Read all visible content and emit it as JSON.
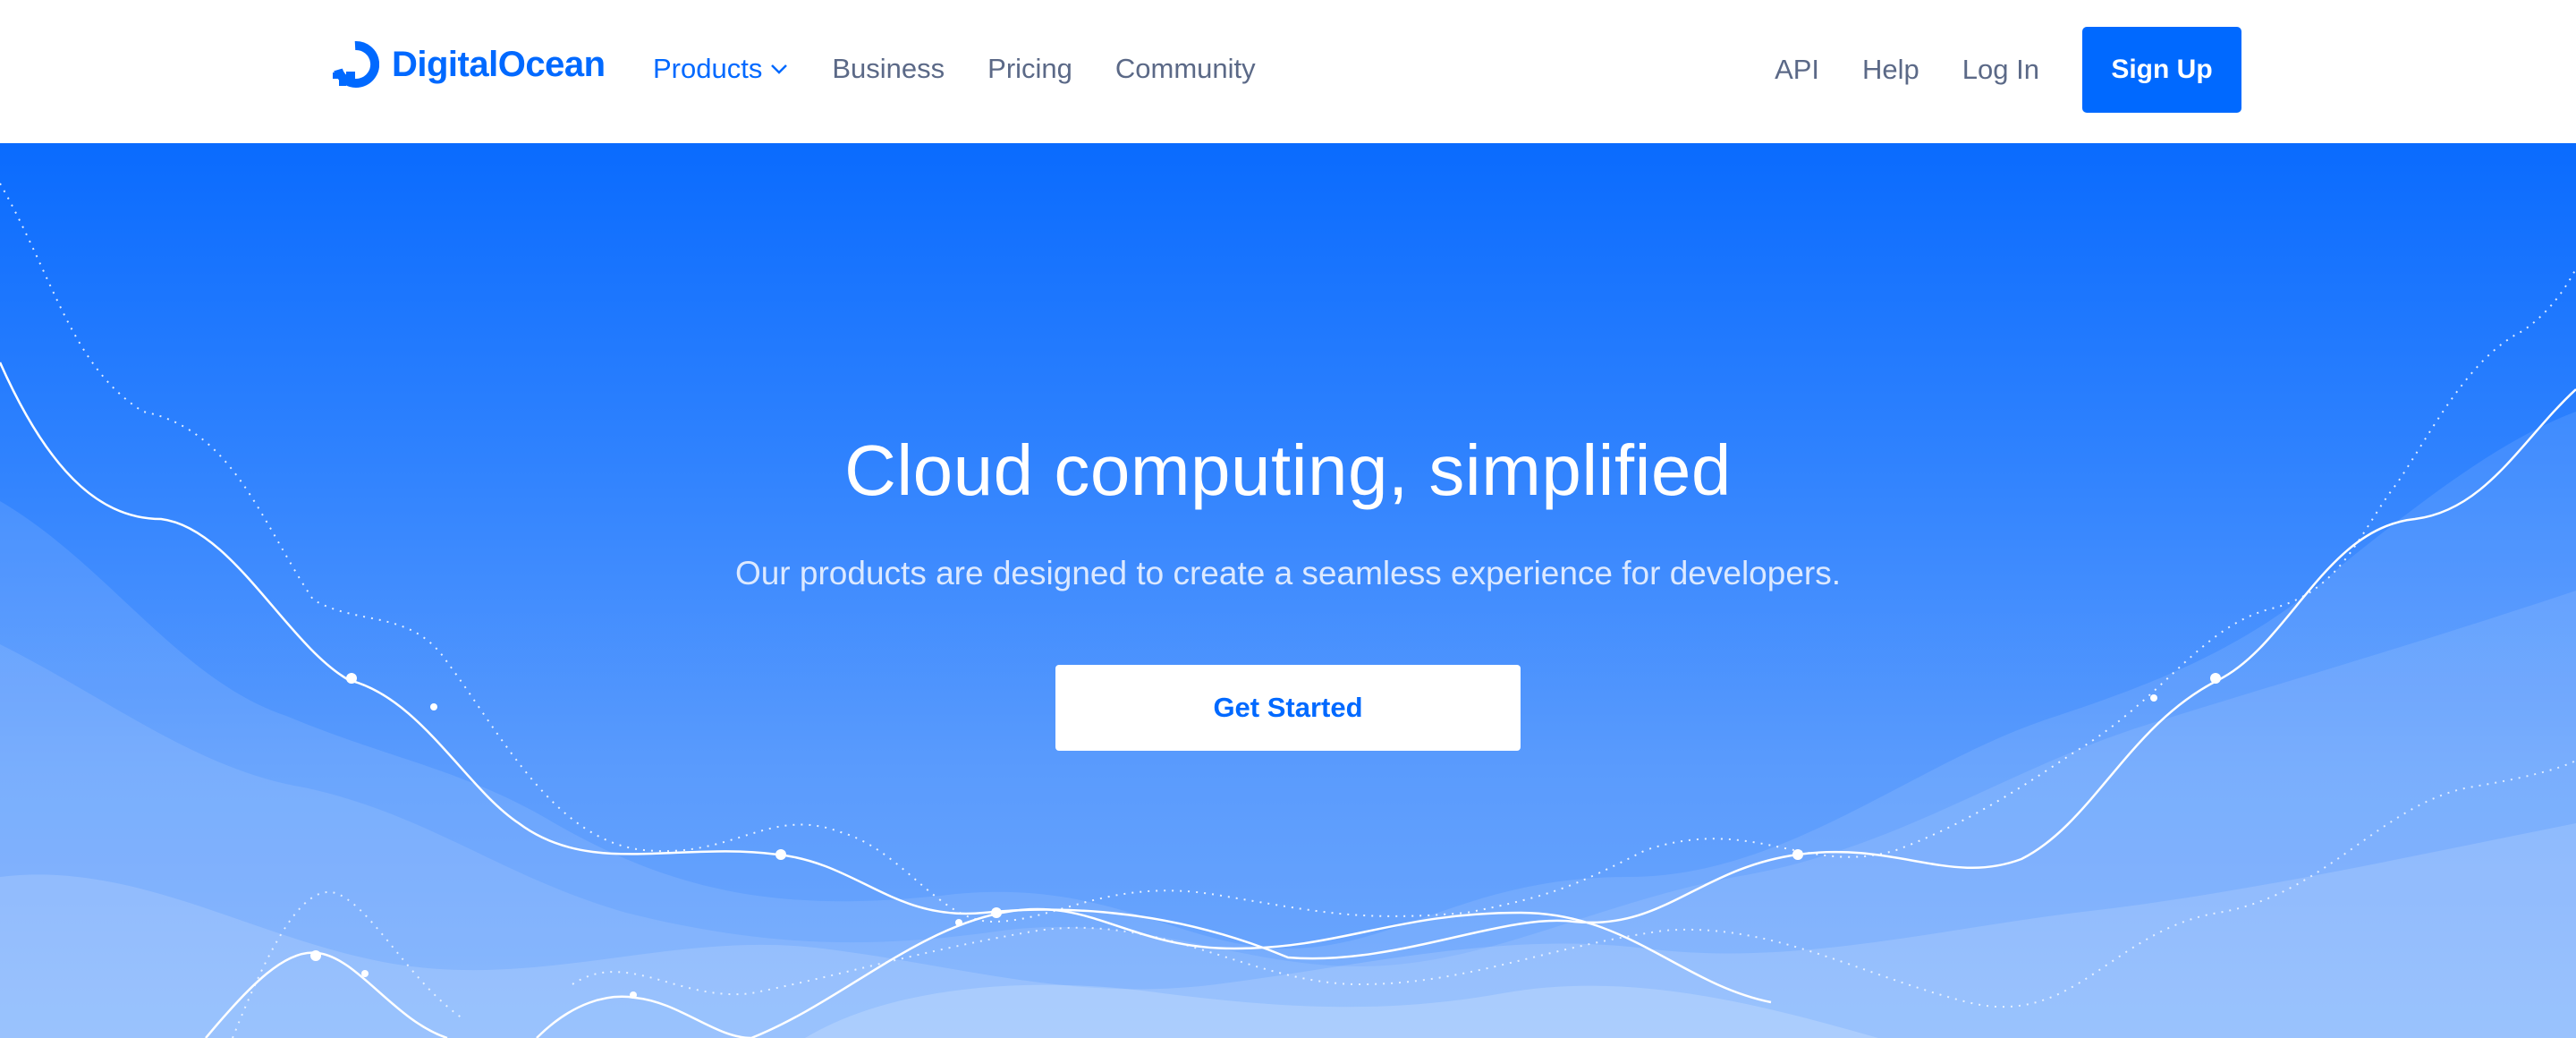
{
  "brand": {
    "name": "DigitalOcean",
    "accent_color": "#0069ff"
  },
  "nav": {
    "left": [
      {
        "label": "Products",
        "has_dropdown": true,
        "active": true
      },
      {
        "label": "Business"
      },
      {
        "label": "Pricing"
      },
      {
        "label": "Community"
      }
    ],
    "right": [
      {
        "label": "API"
      },
      {
        "label": "Help"
      },
      {
        "label": "Log In"
      }
    ],
    "signup_label": "Sign Up"
  },
  "hero": {
    "title": "Cloud computing, simplified",
    "subtitle": "Our products are designed to create a seamless experience for developers.",
    "cta_label": "Get Started",
    "background_top": "#0a6bfe",
    "background_bottom": "#6fa8fd"
  },
  "icons": {
    "logo": "digitalocean-logo-icon",
    "dropdown": "chevron-down-icon"
  }
}
